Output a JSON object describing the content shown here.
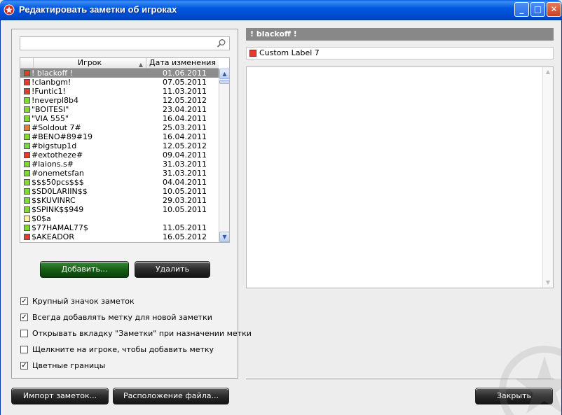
{
  "window": {
    "title": "Редактировать заметки об игроках",
    "min_glyph": "_",
    "max_glyph": "□",
    "close_glyph": "✕"
  },
  "search": {
    "value": "",
    "placeholder": ""
  },
  "list": {
    "columns": {
      "player": "Игрок",
      "date": "Дата изменения"
    },
    "rows": [
      {
        "name": "! blackoff !",
        "date": "01.06.2011",
        "color": "#e53b2c",
        "selected": true
      },
      {
        "name": "!clanbgm!",
        "date": "07.05.2011",
        "color": "#e53b2c"
      },
      {
        "name": "!Funtic1!",
        "date": "11.03.2011",
        "color": "#e53b2c"
      },
      {
        "name": "!neverpl8b4",
        "date": "12.05.2012",
        "color": "#7fdc2e"
      },
      {
        "name": "\"BOITESI\"",
        "date": "23.04.2011",
        "color": "#7fdc2e"
      },
      {
        "name": "\"VIA 555\"",
        "date": "16.04.2011",
        "color": "#7fdc2e"
      },
      {
        "name": "#Soldout 7#",
        "date": "25.03.2011",
        "color": "#f07830"
      },
      {
        "name": "#BENO#89#19",
        "date": "16.04.2011",
        "color": "#7fdc2e"
      },
      {
        "name": "#bigstup1d",
        "date": "12.05.2012",
        "color": "#7fdc2e"
      },
      {
        "name": "#extotheze#",
        "date": "09.04.2011",
        "color": "#e53b2c"
      },
      {
        "name": "#laions.s#",
        "date": "31.03.2011",
        "color": "#7fdc2e"
      },
      {
        "name": "#onemetsfan",
        "date": "31.03.2011",
        "color": "#7fdc2e"
      },
      {
        "name": "$$$50pcs$$$",
        "date": "04.04.2011",
        "color": "#7fdc2e"
      },
      {
        "name": "$SD0LARIIN$$",
        "date": "10.05.2011",
        "color": "#7fdc2e"
      },
      {
        "name": "$$KUVINRC",
        "date": "29.03.2011",
        "color": "#7fdc2e"
      },
      {
        "name": "$SPINK$$949",
        "date": "10.05.2011",
        "color": "#7fdc2e"
      },
      {
        "name": "$0$a",
        "date": "",
        "color": "#fff59a"
      },
      {
        "name": "$77HAMAL77$",
        "date": "11.05.2011",
        "color": "#7fdc2e"
      },
      {
        "name": "$AKEADOR",
        "date": "16.05.2012",
        "color": "#e53b2c"
      }
    ]
  },
  "buttons": {
    "add": "Добавить...",
    "delete": "Удалить",
    "import": "Импорт заметок...",
    "location": "Расположение файла...",
    "close": "Закрыть"
  },
  "options": [
    {
      "label": "Крупный значок заметок",
      "checked": true
    },
    {
      "label": "Всегда добавлять метку для новой заметки",
      "checked": true
    },
    {
      "label": "Открывать вкладку \"Заметки\" при назначении метки",
      "checked": false
    },
    {
      "label": "Щелкните на игроке, чтобы добавить метку",
      "checked": false
    },
    {
      "label": "Цветные границы",
      "checked": true
    }
  ],
  "selected_player": {
    "name": "! blackoff !",
    "label": "Custom Label 7",
    "label_color": "#e53b2c",
    "notes": ""
  }
}
